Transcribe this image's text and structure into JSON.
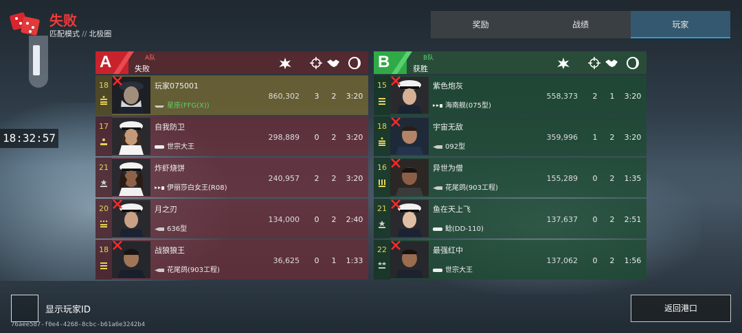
{
  "header": {
    "title": "失败",
    "mode": "匹配模式",
    "separator": "//",
    "map": "北极圈",
    "clock": "18:32:57"
  },
  "tabs": [
    {
      "label": "奖励",
      "active": false
    },
    {
      "label": "战绩",
      "active": false
    },
    {
      "label": "玩家",
      "active": true
    }
  ],
  "teams": {
    "a": {
      "badge": "A",
      "name": "A队",
      "result": "失败",
      "color": "#c8232c",
      "players": [
        {
          "level": "18",
          "name": "玩家075001",
          "ship": "星座(FFG(X))",
          "score": "860,302",
          "kills": "3",
          "assists": "2",
          "time": "3:20",
          "destroyed": true,
          "self": true
        },
        {
          "level": "17",
          "name": "自我防卫",
          "ship": "世宗大王",
          "score": "298,889",
          "kills": "0",
          "assists": "2",
          "time": "3:20",
          "destroyed": false,
          "self": false
        },
        {
          "level": "21",
          "name": "炸虾烧饼",
          "ship": "伊丽莎白女王(R08)",
          "score": "240,957",
          "kills": "2",
          "assists": "2",
          "time": "3:20",
          "destroyed": false,
          "self": false
        },
        {
          "level": "20",
          "name": "月之刃",
          "ship": "636型",
          "score": "134,000",
          "kills": "0",
          "assists": "2",
          "time": "2:40",
          "destroyed": true,
          "self": false
        },
        {
          "level": "18",
          "name": "战狼狼王",
          "ship": "花尾鸽(903工程)",
          "score": "36,625",
          "kills": "0",
          "assists": "1",
          "time": "1:33",
          "destroyed": true,
          "self": false
        }
      ]
    },
    "b": {
      "badge": "B",
      "name": "B队",
      "result": "获胜",
      "color": "#2faa47",
      "players": [
        {
          "level": "15",
          "name": "紫色炮灰",
          "ship": "海南舰(075型)",
          "score": "558,373",
          "kills": "2",
          "assists": "1",
          "time": "3:20",
          "destroyed": true
        },
        {
          "level": "18",
          "name": "宇宙无敌",
          "ship": "092型",
          "score": "359,996",
          "kills": "1",
          "assists": "2",
          "time": "3:20",
          "destroyed": true
        },
        {
          "level": "16",
          "name": "异世为僧",
          "ship": "花尾鸽(903工程)",
          "score": "155,289",
          "kills": "0",
          "assists": "2",
          "time": "1:35",
          "destroyed": true
        },
        {
          "level": "21",
          "name": "鱼在天上飞",
          "ship": "鲶(DD-110)",
          "score": "137,637",
          "kills": "0",
          "assists": "2",
          "time": "2:51",
          "destroyed": true
        },
        {
          "level": "22",
          "name": "最强红中",
          "ship": "世宗大王",
          "score": "137,062",
          "kills": "0",
          "assists": "2",
          "time": "1:56",
          "destroyed": true
        }
      ]
    }
  },
  "footer": {
    "show_id_label": "显示玩家ID",
    "uid": "76aee587-f0e4-4268-8cbc-b61a6e3242b4",
    "back_label": "返回港口"
  },
  "icons": {
    "score": "explosion-icon",
    "kills": "crosshair-icon",
    "assists": "handshake-icon",
    "time": "clock-icon"
  }
}
